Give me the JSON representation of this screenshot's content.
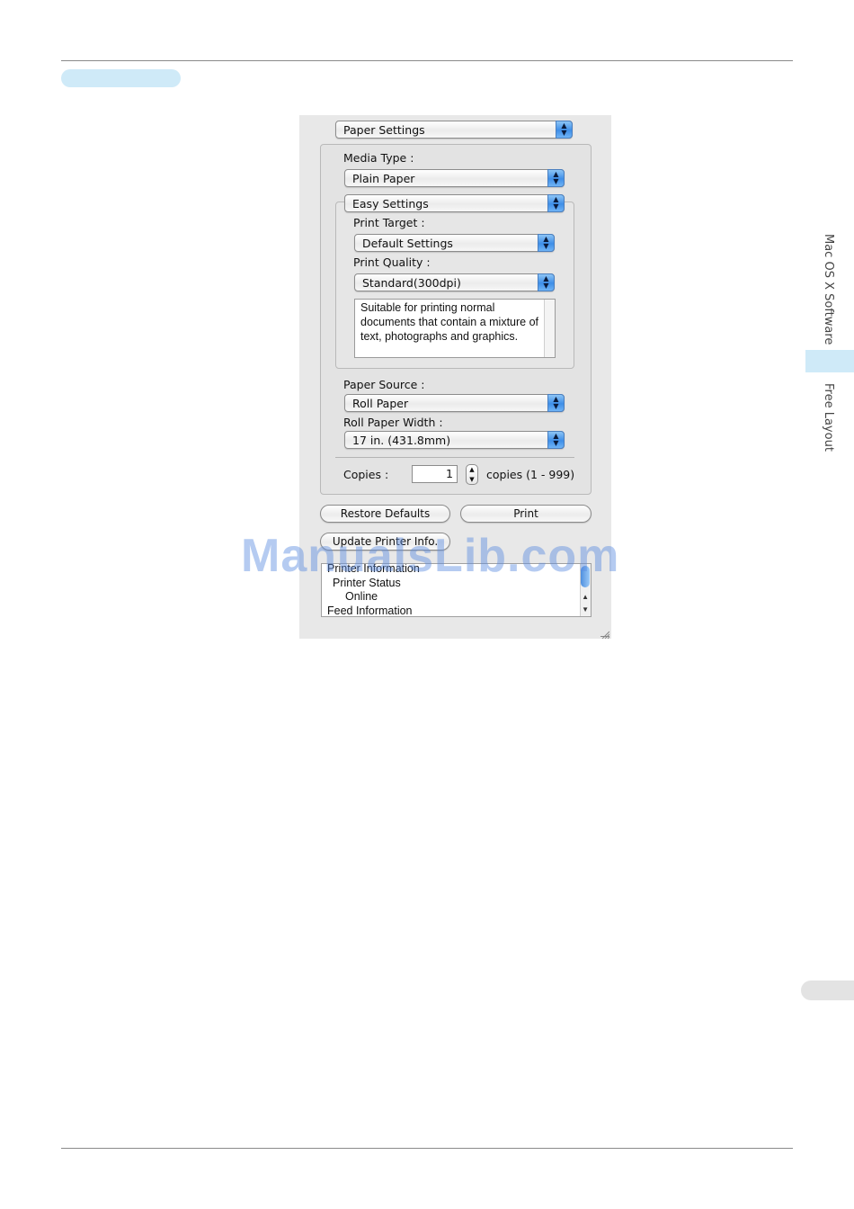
{
  "side_tabs": {
    "section": "Mac OS X Software",
    "subsection": "Free Layout"
  },
  "dialog": {
    "panel_popup": "Paper Settings",
    "media_type_label": "Media Type :",
    "media_type_value": "Plain Paper",
    "easy_settings": "Easy Settings",
    "print_target_label": "Print Target :",
    "print_target_value": "Default Settings",
    "print_quality_label": "Print Quality :",
    "print_quality_value": "Standard(300dpi)",
    "quality_description": "Suitable for printing normal documents that contain a mixture of text, photographs and graphics.",
    "paper_source_label": "Paper Source :",
    "paper_source_value": "Roll Paper",
    "roll_width_label": "Roll Paper Width :",
    "roll_width_value": "17 in. (431.8mm)",
    "copies_label": "Copies :",
    "copies_value": "1",
    "copies_range": "copies (1 - 999)",
    "restore_defaults": "Restore Defaults",
    "print": "Print",
    "update_printer_info": "Update Printer Info."
  },
  "printer_info": {
    "rows": [
      "Printer Information",
      "Printer Status",
      "Online",
      "Feed Information"
    ]
  },
  "watermark": "ManualsLib.com",
  "icons": {
    "popup_arrows": "up-down-arrows-icon",
    "stepper": "stepper-icon",
    "resize": "resize-grip-icon"
  }
}
